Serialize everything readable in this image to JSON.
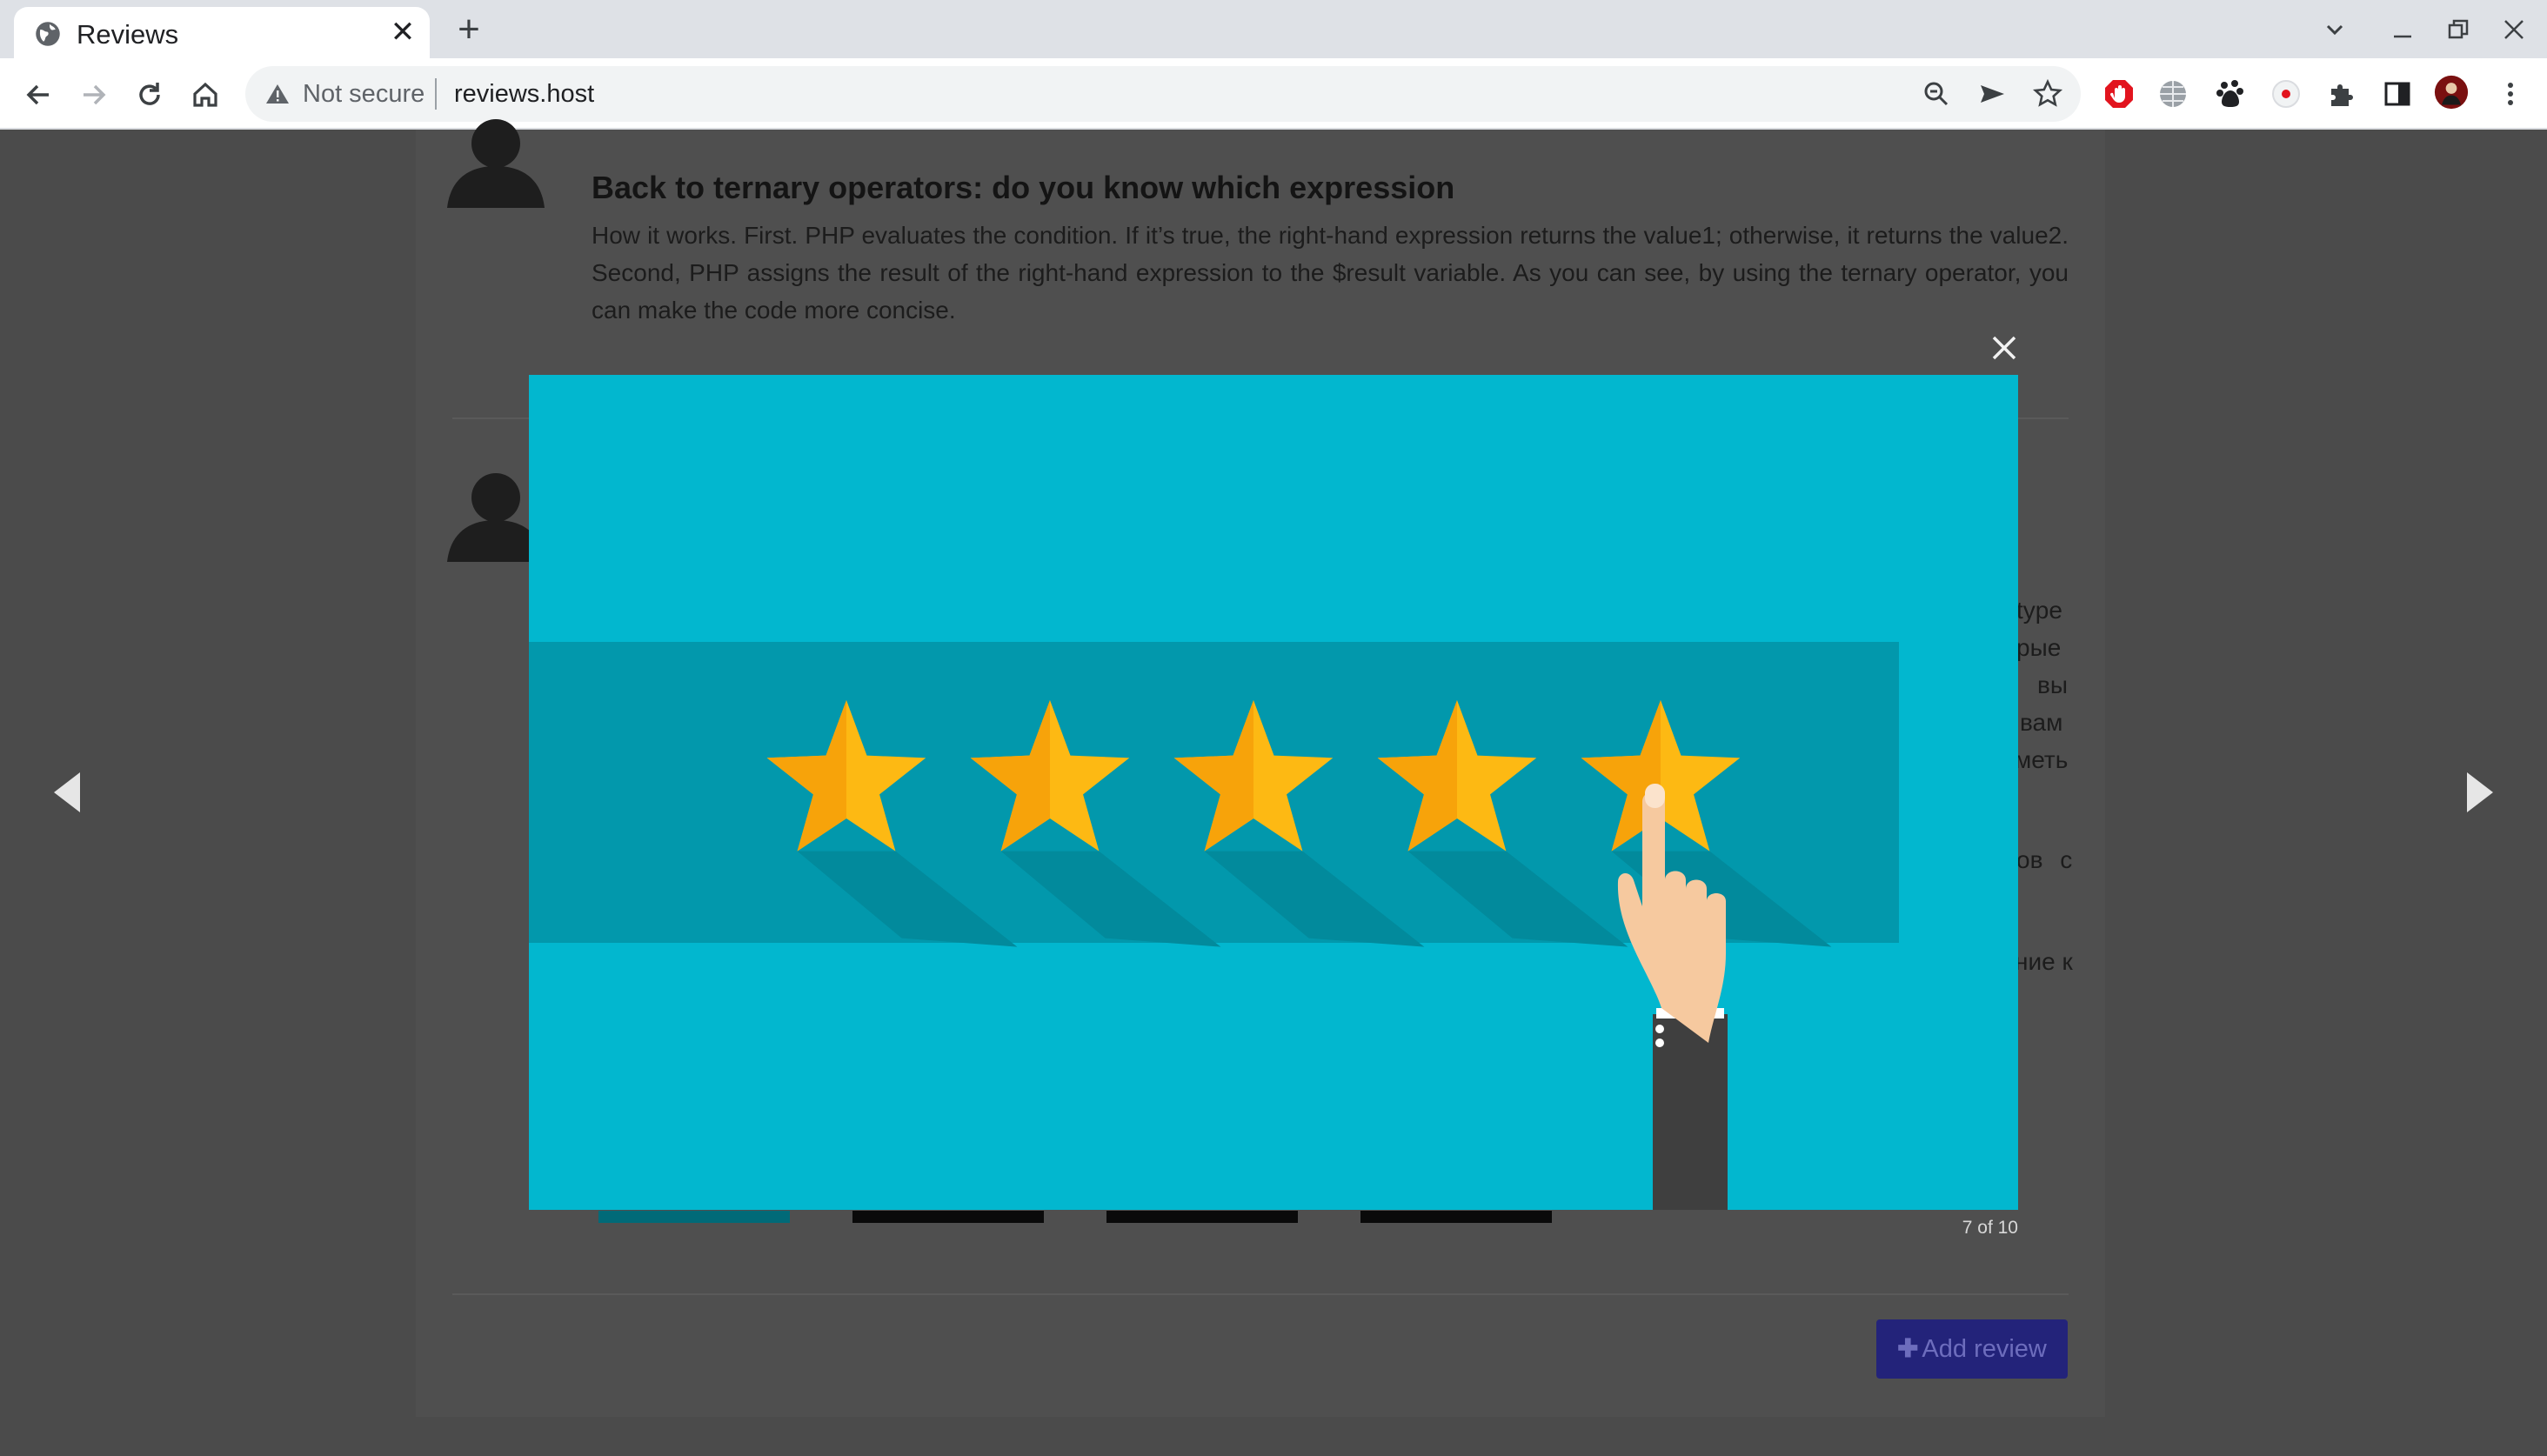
{
  "browser": {
    "tab_title": "Reviews",
    "tab_close": "✕",
    "new_tab": "+",
    "security_label": "Not secure",
    "url": "reviews.host"
  },
  "review": {
    "title": "Back to ternary operators: do you know which expression",
    "body": "How it works. First. PHP evaluates the condition. If it’s true, the right-hand expression returns the value1; otherwise, it returns the value2. Second, PHP assigns the result of the right-hand expression to the $result variable. As you can see, by using the ternary operator, you can make the code more concise."
  },
  "second_review_fragments": [
    "type",
    "рые",
    "вы",
    "вам",
    "меть",
    "ов с",
    "ние к"
  ],
  "add_review_label": "Add review",
  "lightbox": {
    "counter": "7 of 10",
    "rating_stars": 5,
    "rating_max": 5
  },
  "colors": {
    "lightbox_bg": "#02b7cf",
    "rating_band": "#0298ac",
    "star": "#fdb913",
    "add_review_button": "#23237a"
  }
}
